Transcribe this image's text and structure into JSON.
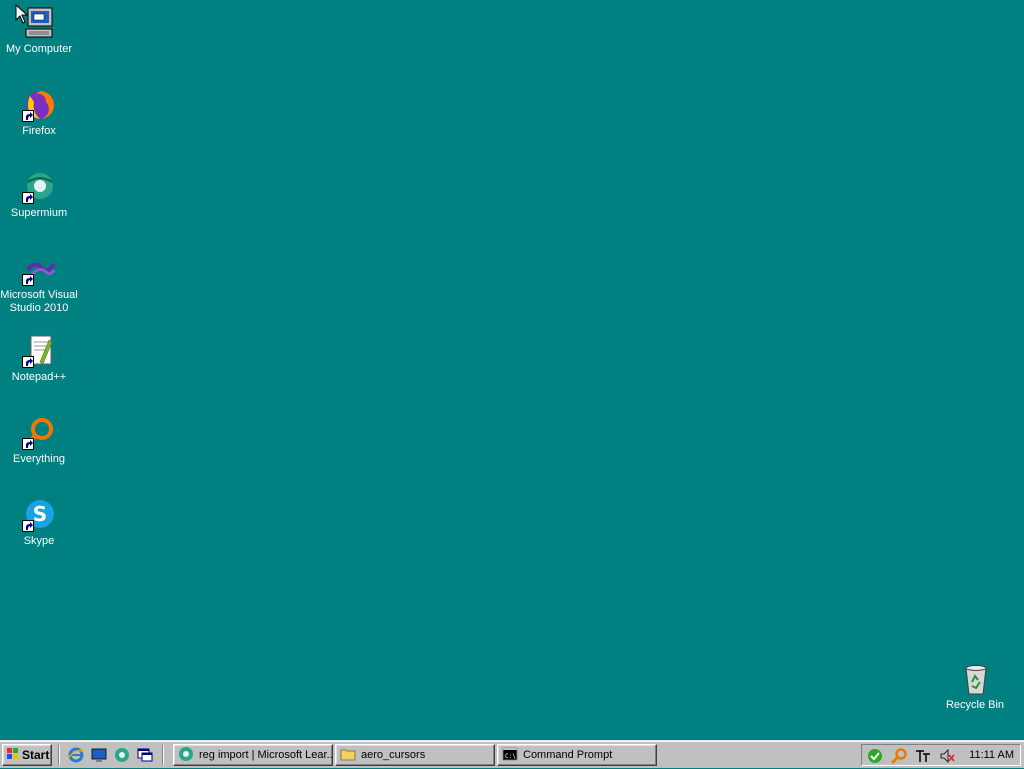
{
  "desktop": {
    "background": "#008080",
    "icons": [
      {
        "label": "My Computer",
        "icon": "computer-icon"
      },
      {
        "label": "Firefox",
        "icon": "firefox-icon"
      },
      {
        "label": "Supermium",
        "icon": "supermium-icon"
      },
      {
        "label": "Microsoft Visual Studio 2010",
        "icon": "visual-studio-icon"
      },
      {
        "label": "Notepad++",
        "icon": "notepad-plus-plus-icon"
      },
      {
        "label": "Everything",
        "icon": "everything-search-icon"
      },
      {
        "label": "Skype",
        "icon": "skype-icon"
      },
      {
        "label": "Recycle Bin",
        "icon": "recycle-bin-icon"
      }
    ]
  },
  "taskbar": {
    "start_label": "Start",
    "quick_launch": [
      "internet-explorer-icon",
      "show-desktop-icon",
      "supermium-icon",
      "window-switch-icon"
    ],
    "tasks": [
      {
        "label": "reg import | Microsoft Lear...",
        "icon": "supermium-icon"
      },
      {
        "label": "aero_cursors",
        "icon": "folder-icon"
      },
      {
        "label": "Command Prompt",
        "icon": "command-prompt-icon"
      }
    ],
    "tray": {
      "icons": [
        "security-check-icon",
        "search-magnifier-icon",
        "input-method-icon",
        "volume-muted-icon"
      ],
      "clock": "11:11 AM"
    }
  }
}
